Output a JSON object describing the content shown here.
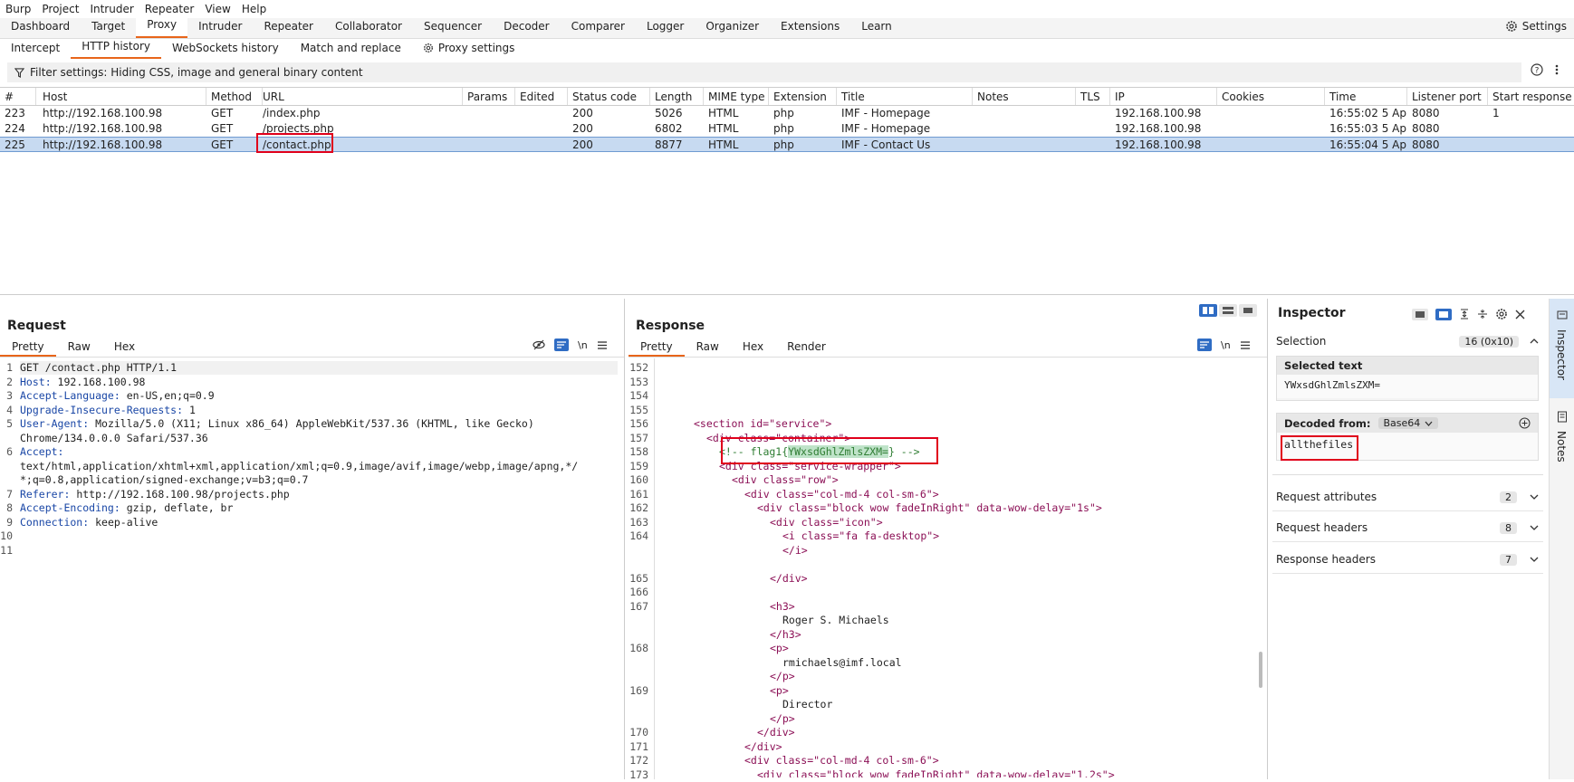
{
  "menu": [
    "Burp",
    "Project",
    "Intruder",
    "Repeater",
    "View",
    "Help"
  ],
  "main_tabs": [
    "Dashboard",
    "Target",
    "Proxy",
    "Intruder",
    "Repeater",
    "Collaborator",
    "Sequencer",
    "Decoder",
    "Comparer",
    "Logger",
    "Organizer",
    "Extensions",
    "Learn"
  ],
  "settings_label": "Settings",
  "sub_tabs": [
    "Intercept",
    "HTTP history",
    "WebSockets history",
    "Match and replace",
    "Proxy settings"
  ],
  "filter_text": "Filter settings: Hiding CSS, image and general binary content",
  "columns": [
    "#",
    "Host",
    "Method",
    "URL",
    "Params",
    "Edited",
    "Status code",
    "Length",
    "MIME type",
    "Extension",
    "Title",
    "Notes",
    "TLS",
    "IP",
    "Cookies",
    "Time",
    "Listener port",
    "Start response t"
  ],
  "rows": [
    {
      "id": "223",
      "host": "http://192.168.100.98",
      "method": "GET",
      "url": "/index.php",
      "status": "200",
      "length": "5026",
      "mime": "HTML",
      "ext": "php",
      "title": "IMF - Homepage",
      "ip": "192.168.100.98",
      "time": "16:55:02 5 Apr...",
      "port": "8080",
      "start": "1"
    },
    {
      "id": "224",
      "host": "http://192.168.100.98",
      "method": "GET",
      "url": "/projects.php",
      "status": "200",
      "length": "6802",
      "mime": "HTML",
      "ext": "php",
      "title": "IMF - Homepage",
      "ip": "192.168.100.98",
      "time": "16:55:03 5 Apr...",
      "port": "8080",
      "start": ""
    },
    {
      "id": "225",
      "host": "http://192.168.100.98",
      "method": "GET",
      "url": "/contact.php",
      "status": "200",
      "length": "8877",
      "mime": "HTML",
      "ext": "php",
      "title": "IMF - Contact Us",
      "ip": "192.168.100.98",
      "time": "16:55:04 5 Apr...",
      "port": "8080",
      "start": ""
    }
  ],
  "request": {
    "title": "Request",
    "tabs": [
      "Pretty",
      "Raw",
      "Hex"
    ],
    "lines": [
      {
        "n": "1",
        "k": "",
        "v": "GET /contact.php HTTP/1.1"
      },
      {
        "n": "2",
        "k": "Host:",
        "v": " 192.168.100.98"
      },
      {
        "n": "3",
        "k": "Accept-Language:",
        "v": " en-US,en;q=0.9"
      },
      {
        "n": "4",
        "k": "Upgrade-Insecure-Requests:",
        "v": " 1"
      },
      {
        "n": "5",
        "k": "User-Agent:",
        "v": " Mozilla/5.0 (X11; Linux x86_64) AppleWebKit/537.36 (KHTML, like Gecko)"
      },
      {
        "n": "",
        "k": "",
        "v": "Chrome/134.0.0.0 Safari/537.36"
      },
      {
        "n": "6",
        "k": "Accept:",
        "v": ""
      },
      {
        "n": "",
        "k": "",
        "v": "text/html,application/xhtml+xml,application/xml;q=0.9,image/avif,image/webp,image/apng,*/"
      },
      {
        "n": "",
        "k": "",
        "v": "*;q=0.8,application/signed-exchange;v=b3;q=0.7"
      },
      {
        "n": "7",
        "k": "Referer:",
        "v": " http://192.168.100.98/projects.php"
      },
      {
        "n": "8",
        "k": "Accept-Encoding:",
        "v": " gzip, deflate, br"
      },
      {
        "n": "9",
        "k": "Connection:",
        "v": " keep-alive"
      },
      {
        "n": "10",
        "k": "",
        "v": ""
      },
      {
        "n": "11",
        "k": "",
        "v": ""
      }
    ]
  },
  "response": {
    "title": "Response",
    "tabs": [
      "Pretty",
      "Raw",
      "Hex",
      "Render"
    ],
    "gutter": [
      "152",
      "153",
      "154",
      "155",
      "156",
      "157",
      "158",
      "159",
      "160",
      "161",
      "162",
      "163",
      "164",
      "",
      "",
      "165",
      "166",
      "167",
      "",
      "",
      "168",
      "",
      "",
      "169",
      "",
      "",
      "170",
      "171",
      "172",
      "173"
    ],
    "l156_tag": "<section id=\"service\">",
    "l157_tag": "<div class=\"container\">",
    "l158_pre": "<!-- flag1{",
    "l158_hl": "YWxsdGhlZmlsZXM=",
    "l158_post": "} -->",
    "l159_tag": "<div class=\"service-wrapper\">",
    "l160_tag": "<div class=\"row\">",
    "l161_tag": "<div class=\"col-md-4 col-sm-6\">",
    "l162_tag": "<div class=\"block wow fadeInRight\" data-wow-delay=\"1s\">",
    "l163_tag": "<div class=\"icon\">",
    "l164_tag": "<i class=\"fa fa-desktop\">",
    "l164b": "</i>",
    "l165": "</div>",
    "h3o": "<h3>",
    "name": "Roger S. Michaels",
    "h3c": "</h3>",
    "po": "<p>",
    "email": "rmichaels@imf.local",
    "pc": "</p>",
    "po2": "<p>",
    "role": "Director",
    "pc2": "</p>",
    "d1": "</div>",
    "d2": "</div>",
    "l172_tag": "<div class=\"col-md-4 col-sm-6\">",
    "l173_tag": "<div class=\"block wow fadeInRight\" data-wow-delay=\"1.2s\">"
  },
  "inspector": {
    "title": "Inspector",
    "selection": "Selection",
    "selection_count": "16 (0x10)",
    "selected_text_label": "Selected text",
    "selected_text": "YWxsdGhlZmlsZXM=",
    "decoded_from": "Decoded from:",
    "decoder": "Base64",
    "decoded": "allthefiles",
    "sections": [
      {
        "label": "Request attributes",
        "count": "2"
      },
      {
        "label": "Request headers",
        "count": "8"
      },
      {
        "label": "Response headers",
        "count": "7"
      }
    ]
  },
  "side_tabs": [
    "Inspector",
    "Notes"
  ],
  "colors": {
    "accent": "#e8651a",
    "highlight": "#e0001b",
    "selection": "#c7daf1"
  }
}
